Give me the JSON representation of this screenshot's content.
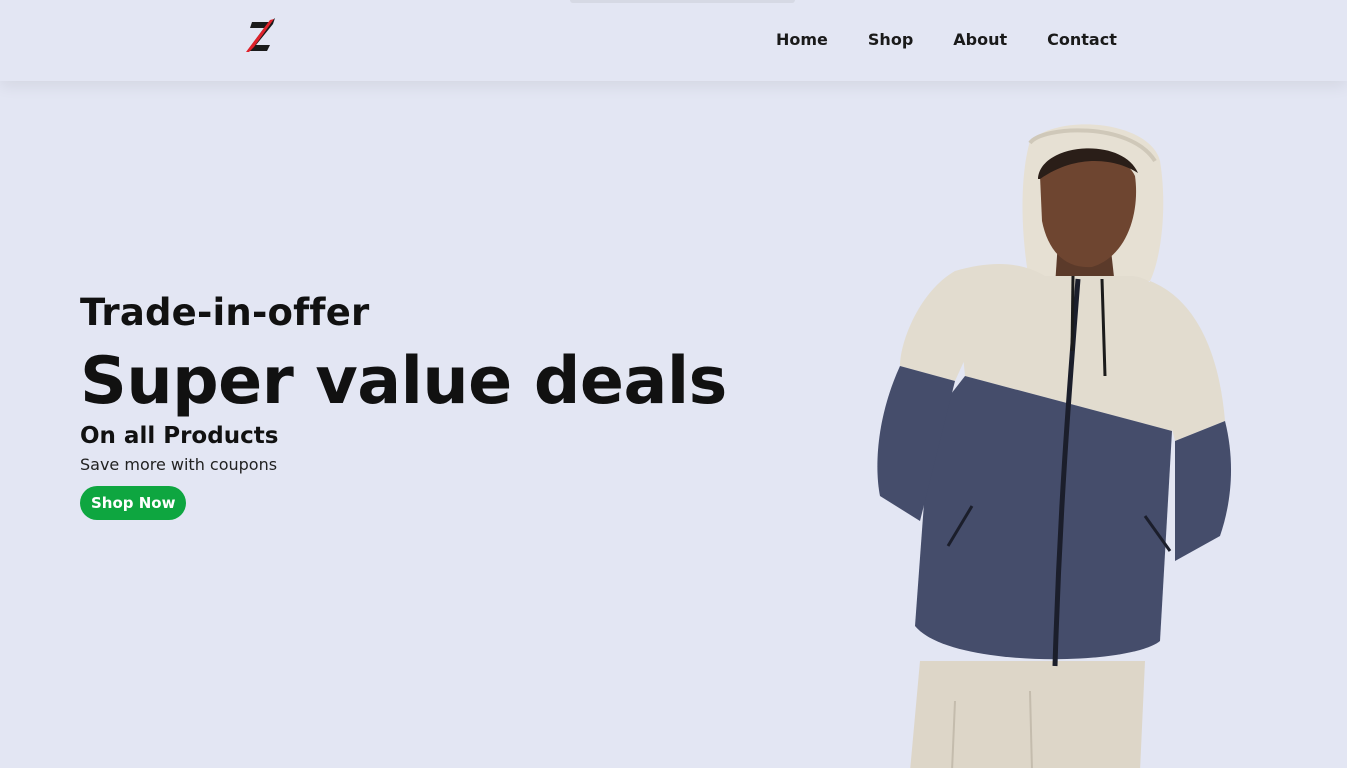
{
  "header": {
    "logo_alt": "Z",
    "nav": [
      {
        "label": "Home"
      },
      {
        "label": "Shop"
      },
      {
        "label": "About"
      },
      {
        "label": "Contact"
      }
    ]
  },
  "hero": {
    "kicker": "Trade-in-offer",
    "headline": "Super value deals",
    "sub_headline": "On all Products",
    "tagline": "Save more with coupons",
    "cta_label": "Shop Now",
    "image_alt": "Model wearing a two-tone hooded zip jacket"
  },
  "colors": {
    "background": "#e3e6f3",
    "accent": "#0ea640",
    "logo_red": "#e0222b",
    "text": "#111111",
    "hoodie_top": "#e2dccf",
    "hoodie_bottom": "#454d6b"
  },
  "icons": {
    "logo": "z-logo-icon"
  }
}
